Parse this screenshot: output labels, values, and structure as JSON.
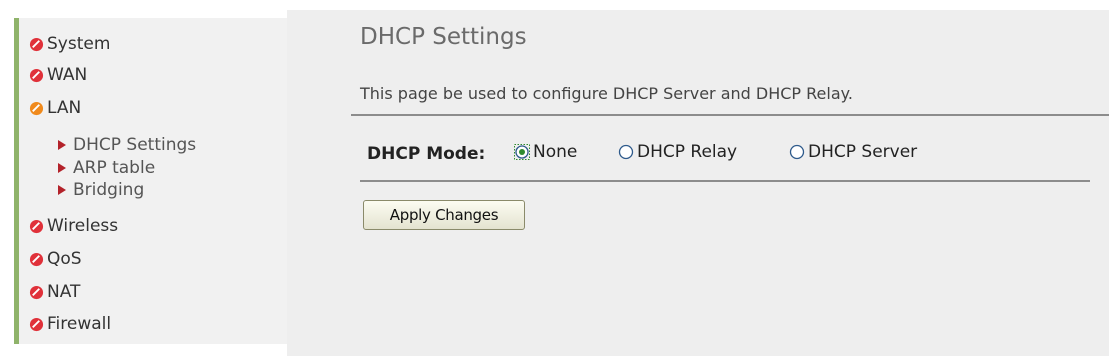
{
  "sidebar": {
    "items": [
      {
        "label": "System",
        "icon": "red-leaf-icon"
      },
      {
        "label": "WAN",
        "icon": "red-leaf-icon"
      },
      {
        "label": "LAN",
        "icon": "orange-leaf-icon"
      },
      {
        "label": "Wireless",
        "icon": "red-leaf-icon"
      },
      {
        "label": "QoS",
        "icon": "red-leaf-icon"
      },
      {
        "label": "NAT",
        "icon": "red-leaf-icon"
      },
      {
        "label": "Firewall",
        "icon": "red-leaf-icon"
      }
    ],
    "lan_subitems": [
      {
        "label": "DHCP Settings",
        "icon": "red-triangle-icon"
      },
      {
        "label": "ARP table",
        "icon": "red-triangle-icon"
      },
      {
        "label": "Bridging",
        "icon": "red-triangle-icon"
      }
    ]
  },
  "main": {
    "title": "DHCP Settings",
    "description": "This page be used to configure DHCP Server and DHCP Relay.",
    "dhcp_mode": {
      "label": "DHCP Mode:",
      "options": [
        "None",
        "DHCP Relay",
        "DHCP Server"
      ],
      "selected": "None"
    },
    "apply_button": "Apply Changes"
  },
  "colors": {
    "bullet_red": "#e0313a",
    "bullet_orange": "#f08a1c",
    "triangle_red": "#b3222a",
    "accent_green": "#8fb36a",
    "radio_selected": "#2e8b2e"
  }
}
